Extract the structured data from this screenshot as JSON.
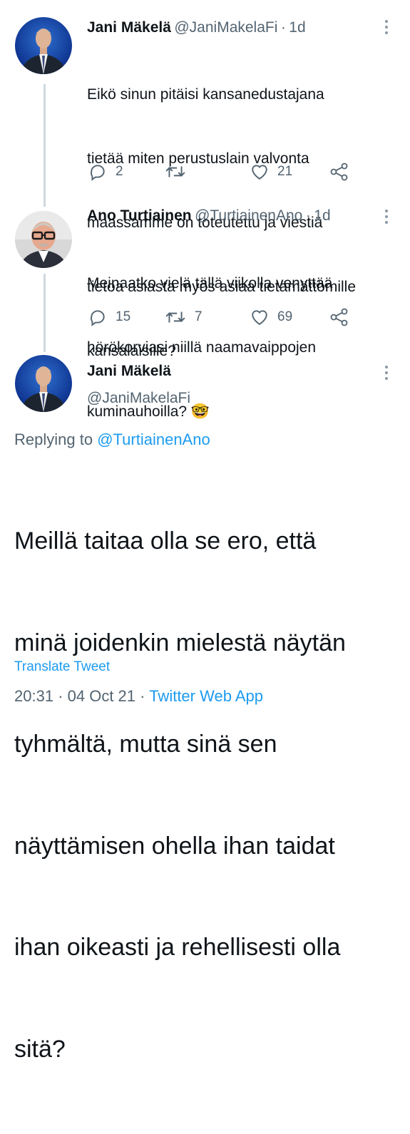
{
  "tweets": [
    {
      "author_name": "Jani Mäkelä",
      "handle": "@JaniMakelaFi",
      "age": "1d",
      "lines": [
        "Eikö sinun pitäisi kansanedustajana",
        "tietää miten perustuslain valvonta",
        "maassamme on toteutettu ja viestiä",
        "tietoa asiasta myös asiaa tietämättömille",
        "kansalaisille?"
      ],
      "replies": "2",
      "retweets": "",
      "likes": "21"
    },
    {
      "author_name": "Ano Turtiainen",
      "handle": "@TurtiainenAno",
      "age": "1d",
      "lines": [
        "Meinaatko vielä tällä viikolla venyttää",
        "hörökorviasi niillä naamavaippojen",
        "kuminauhoilla? 🤓"
      ],
      "replies": "15",
      "retweets": "7",
      "likes": "69"
    }
  ],
  "focused": {
    "author_name": "Jani Mäkelä",
    "handle": "@JaniMakelaFi",
    "replying_prefix": "Replying to",
    "replying_to": "@TurtiainenAno",
    "lines": [
      "Meillä taitaa olla se ero, että",
      "minä joidenkin mielestä näytän",
      "tyhmältä, mutta sinä sen",
      "näyttämisen ohella ihan taidat",
      "ihan oikeasti ja rehellisesti olla",
      "sitä?"
    ],
    "translate_label": "Translate Tweet",
    "time": "20:31",
    "date": "04 Oct 21",
    "source": "Twitter Web App"
  },
  "separator": "·",
  "colors": {
    "link": "#1d9bf0",
    "secondary": "#536471",
    "thread_line": "#cfd9de"
  }
}
